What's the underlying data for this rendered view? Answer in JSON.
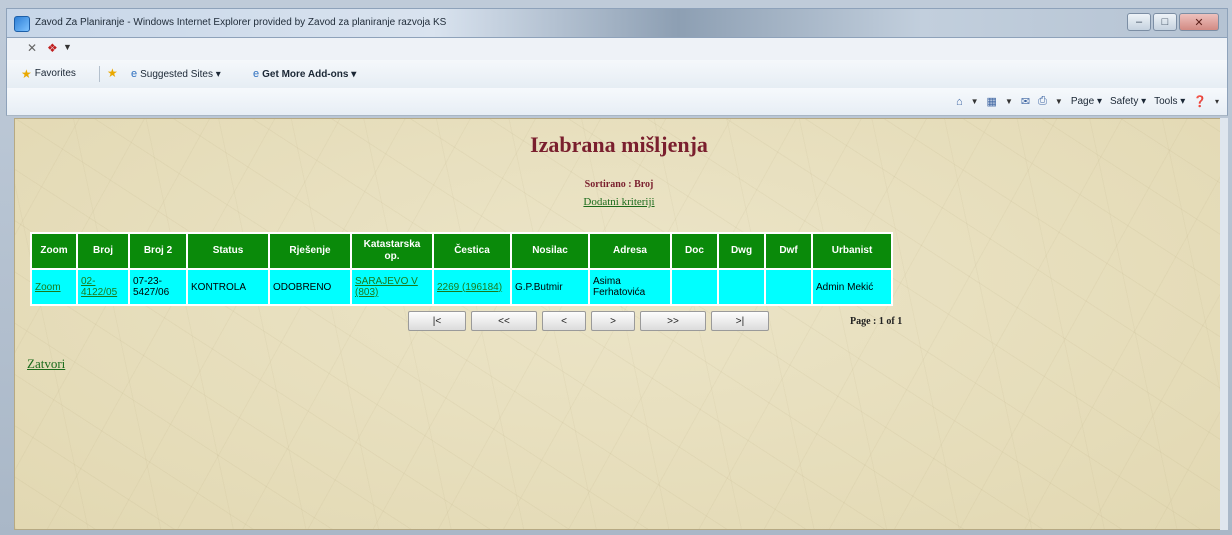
{
  "window": {
    "title": "Zavod Za Planiranje - Windows Internet Explorer provided by Zavod za planiranje razvoja KS"
  },
  "favorites_bar": {
    "favorites_label": "Favorites",
    "suggested_sites_label": "Suggested Sites ▾",
    "get_addons_label": "Get More Add-ons ▾"
  },
  "command_bar": {
    "page_label": "Page ▾",
    "safety_label": "Safety ▾",
    "tools_label": "Tools ▾",
    "help_label": "▾"
  },
  "page": {
    "title": "Izabrana mišljenja",
    "sort_text": "Sortirano : Broj",
    "extra_criteria_link": "Dodatni kriteriji",
    "close_link": "Zatvori",
    "page_info": "Page : 1 of 1"
  },
  "table": {
    "headers": [
      "Zoom",
      "Broj",
      "Broj 2",
      "Status",
      "Rješenje",
      "Katastarska op.",
      "Čestica",
      "Nosilac",
      "Adresa",
      "Doc",
      "Dwg",
      "Dwf",
      "Urbanist"
    ],
    "row": {
      "zoom": "Zoom",
      "broj": "02-4122/05",
      "broj2": "07-23-5427/06",
      "status": "KONTROLA",
      "rjesenje": "ODOBRENO",
      "katastarska": "SARAJEVO V (803)",
      "cestica": "2269 (196184)",
      "nosilac": "G.P.Butmir",
      "adresa": "Asima Ferhatovića",
      "doc": "",
      "dwg": "",
      "dwf": "",
      "urbanist": "Admin Mekić"
    }
  },
  "pager": {
    "first": "|<",
    "prev_block": "<<",
    "prev": "<",
    "next": ">",
    "next_block": ">>",
    "last": ">|"
  },
  "colors": {
    "header_bg": "#0a8a0a",
    "row_bg": "#00ffff",
    "title_color": "#7a1f2e",
    "link_color": "#1b6b1b",
    "page_bg": "#e7dfbf"
  }
}
